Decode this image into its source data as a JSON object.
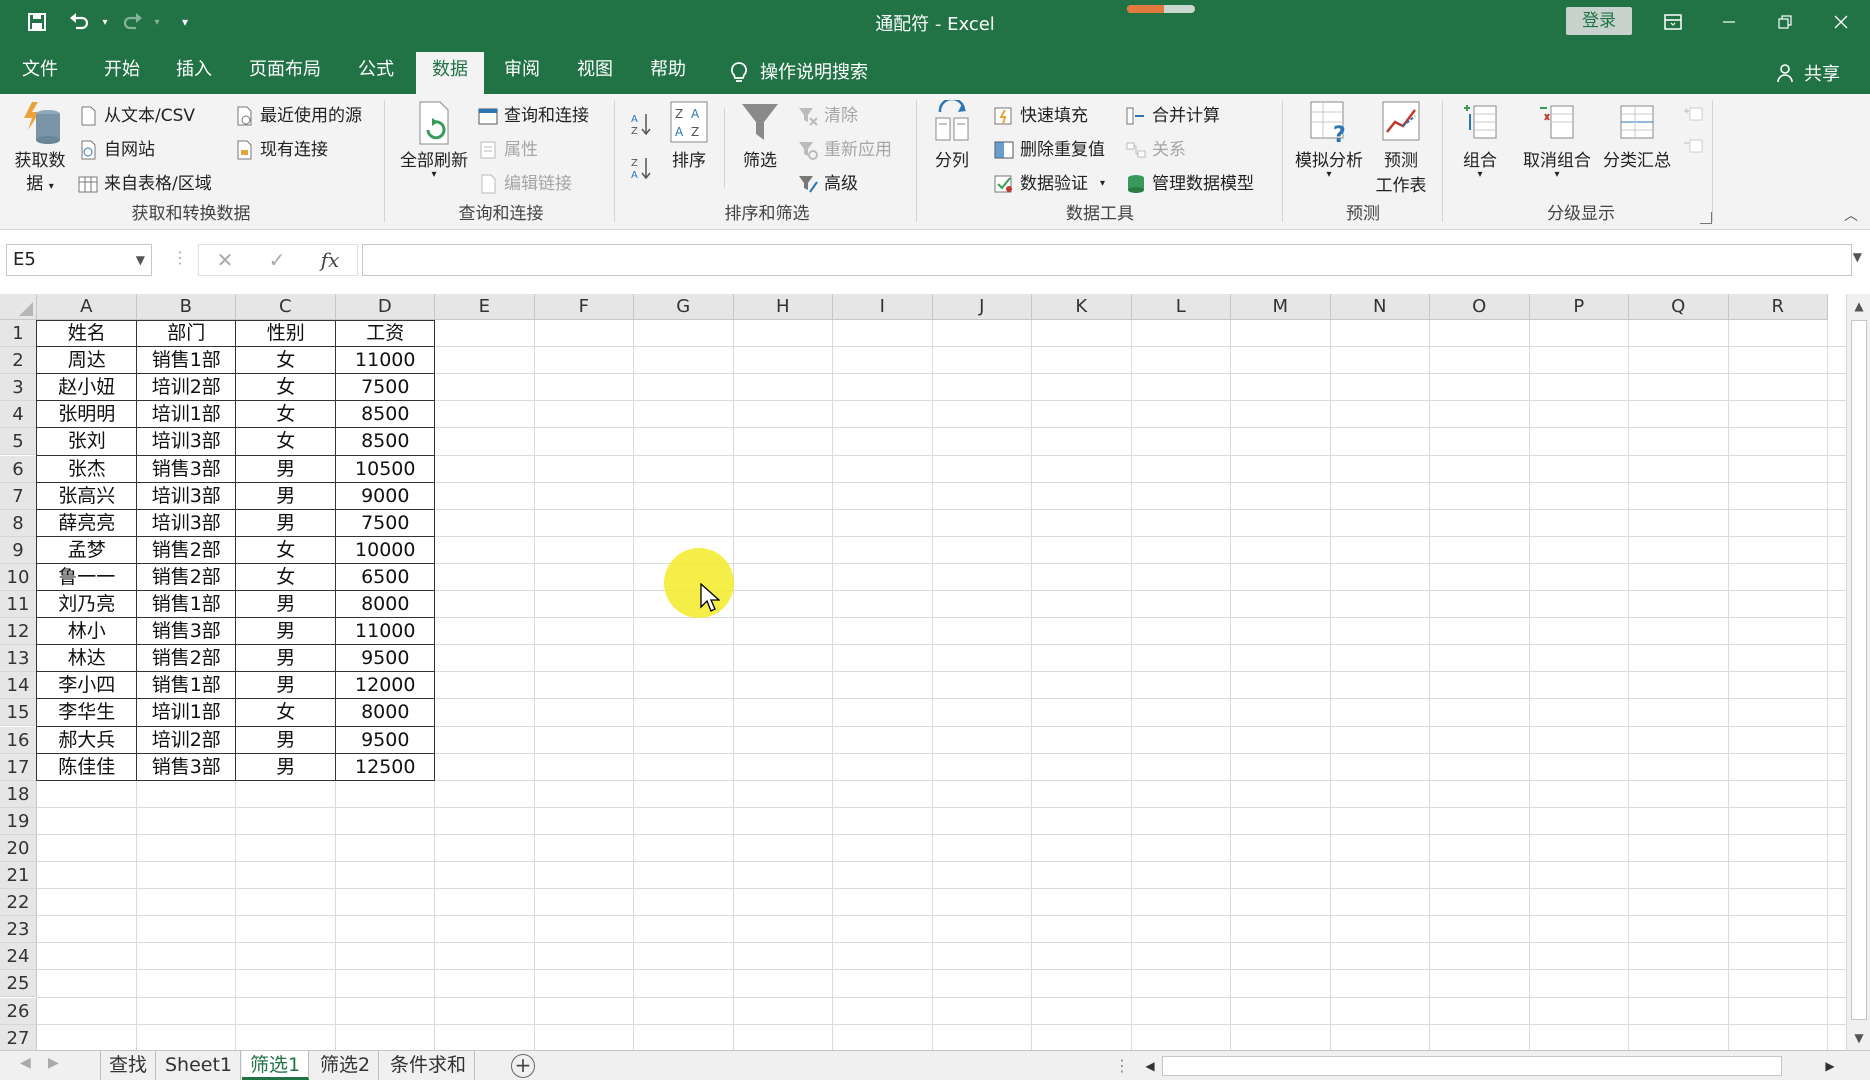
{
  "window": {
    "title": "通配符 - Excel",
    "login": "登录",
    "autosave_progress": 0.55,
    "colors": {
      "accent": "#217346",
      "ribbon_bg": "#f3f3f3"
    }
  },
  "quick_access": {
    "icons": [
      "save-icon",
      "undo-icon",
      "redo-icon",
      "customize-icon"
    ]
  },
  "menu": {
    "tabs": [
      "文件",
      "开始",
      "插入",
      "页面布局",
      "公式",
      "数据",
      "审阅",
      "视图",
      "帮助"
    ],
    "active_tab": "数据",
    "search": "操作说明搜索",
    "share": "共享"
  },
  "ribbon": {
    "get_transform": {
      "label": "获取和转换数据",
      "get_data_line1": "获取数",
      "get_data_line2": "据",
      "from_text_csv": "从文本/CSV",
      "from_web": "自网站",
      "from_table": "来自表格/区域",
      "recent_sources": "最近使用的源",
      "existing_connections": "现有连接"
    },
    "queries": {
      "label": "查询和连接",
      "refresh_all": "全部刷新",
      "queries_connections": "查询和连接",
      "properties": "属性",
      "edit_links": "编辑链接"
    },
    "sort_filter": {
      "label": "排序和筛选",
      "sort": "排序",
      "filter": "筛选",
      "clear": "清除",
      "reapply": "重新应用",
      "advanced": "高级"
    },
    "data_tools": {
      "label": "数据工具",
      "text_to_columns": "分列",
      "flash_fill": "快速填充",
      "remove_duplicates": "删除重复值",
      "data_validation": "数据验证",
      "consolidate": "合并计算",
      "relationships": "关系",
      "manage_data_model": "管理数据模型"
    },
    "forecast": {
      "label": "预测",
      "what_if": "模拟分析",
      "forecast_sheet_line1": "预测",
      "forecast_sheet_line2": "工作表"
    },
    "outline": {
      "label": "分级显示",
      "group": "组合",
      "ungroup": "取消组合",
      "subtotal": "分类汇总"
    }
  },
  "formula_bar": {
    "name_box": "E5",
    "fx": "fx",
    "formula": ""
  },
  "sheet": {
    "columns": [
      "A",
      "B",
      "C",
      "D",
      "E",
      "F",
      "G",
      "H",
      "I",
      "J",
      "K",
      "L",
      "M",
      "N",
      "O",
      "P",
      "Q",
      "R"
    ],
    "row_numbers": [
      "1",
      "2",
      "3",
      "4",
      "5",
      "6",
      "7",
      "8",
      "9",
      "10",
      "11",
      "12",
      "13",
      "14",
      "15",
      "16",
      "17",
      "18",
      "19",
      "20",
      "21",
      "22",
      "23",
      "24",
      "25",
      "26",
      "27"
    ],
    "rows": [
      [
        "姓名",
        "部门",
        "性别",
        "工资"
      ],
      [
        "周达",
        "销售1部",
        "女",
        "11000"
      ],
      [
        "赵小妞",
        "培训2部",
        "女",
        "7500"
      ],
      [
        "张明明",
        "培训1部",
        "女",
        "8500"
      ],
      [
        "张刘",
        "培训3部",
        "女",
        "8500"
      ],
      [
        "张杰",
        "销售3部",
        "男",
        "10500"
      ],
      [
        "张高兴",
        "培训3部",
        "男",
        "9000"
      ],
      [
        "薛亮亮",
        "培训3部",
        "男",
        "7500"
      ],
      [
        "孟梦",
        "销售2部",
        "女",
        "10000"
      ],
      [
        "鲁一一",
        "销售2部",
        "女",
        "6500"
      ],
      [
        "刘乃亮",
        "销售1部",
        "男",
        "8000"
      ],
      [
        "林小",
        "销售3部",
        "男",
        "11000"
      ],
      [
        "林达",
        "销售2部",
        "男",
        "9500"
      ],
      [
        "李小四",
        "销售1部",
        "男",
        "12000"
      ],
      [
        "李华生",
        "培训1部",
        "女",
        "8000"
      ],
      [
        "郝大兵",
        "培训2部",
        "男",
        "9500"
      ],
      [
        "陈佳佳",
        "销售3部",
        "男",
        "12500"
      ]
    ]
  },
  "sheet_tabs": {
    "tabs": [
      "查找",
      "Sheet1",
      "筛选1",
      "筛选2",
      "条件求和"
    ],
    "active": "筛选1"
  }
}
